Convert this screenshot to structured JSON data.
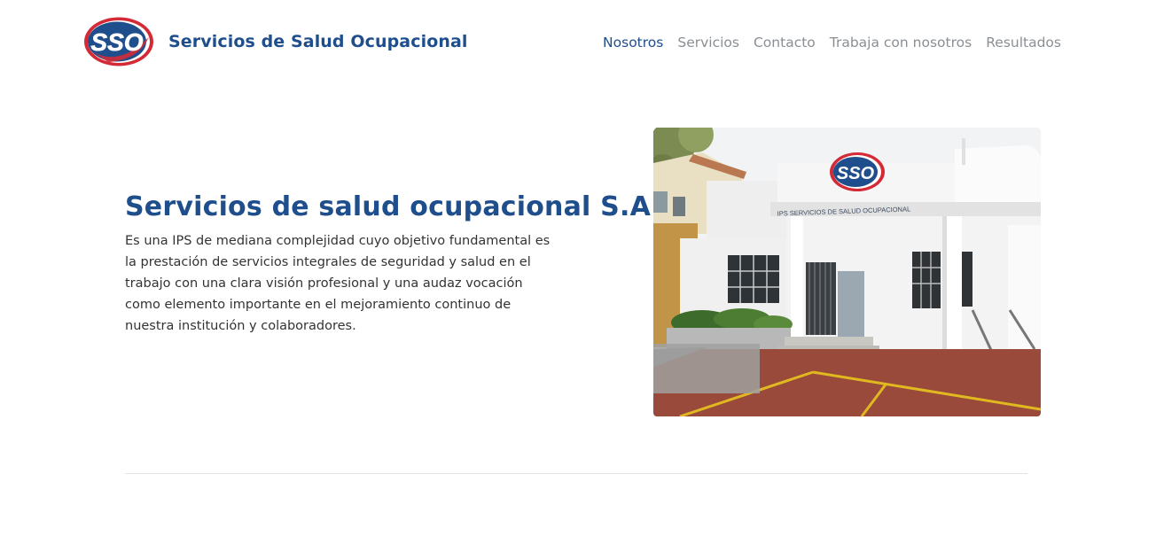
{
  "header": {
    "logo_text": "SSO",
    "brand_title": "Servicios de Salud Ocupacional",
    "nav": [
      {
        "label": "Nosotros",
        "active": true
      },
      {
        "label": "Servicios",
        "active": false
      },
      {
        "label": "Contacto",
        "active": false
      },
      {
        "label": "Trabaja con nosotros",
        "active": false
      },
      {
        "label": "Resultados",
        "active": false
      }
    ]
  },
  "hero": {
    "title": "Servicios de salud ocupacional S.A.S.",
    "description": "Es una IPS de mediana complejidad cuyo objetivo fundamental es la prestación de servicios integrales de seguridad y salud en el trabajo con una clara visión profesional y una audaz vocación como elemento importante en el mejoramiento continuo de nuestra institución y colaboradores.",
    "photo_sign_text": "IPS SERVICIOS DE SALUD OCUPACIONAL",
    "photo_logo_text": "SSO"
  },
  "colors": {
    "brand_blue": "#1f4e8c",
    "logo_red": "#d42a36",
    "nav_gray": "#8a8f94",
    "text": "#333333"
  }
}
